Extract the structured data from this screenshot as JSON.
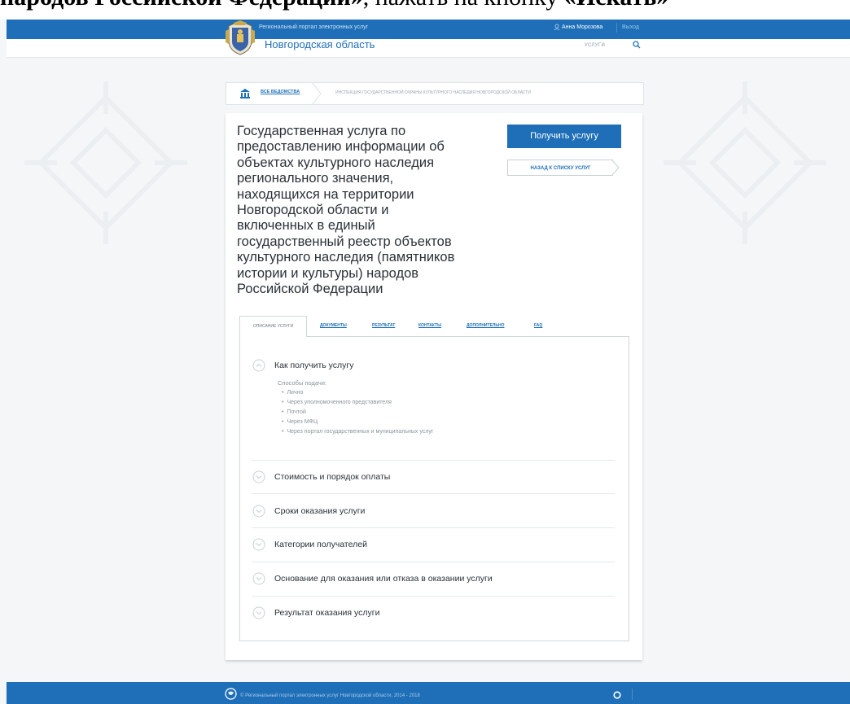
{
  "caption": {
    "part1": "народов Российской Федерации»",
    "part2": ", нажать на кнопку ",
    "part3": "«Искать»"
  },
  "topbar": {
    "portal_label": "Региональный портал электронных услуг",
    "user_name": "Анна Морозова",
    "logout_label": "Выход"
  },
  "header": {
    "region": "Новгородская область",
    "nav_services": "УСЛУГИ"
  },
  "breadcrumb": {
    "all_label": "ВСЕ ВЕДОМСТВА",
    "department": "ИНСПЕКЦИЯ ГОСУДАРСТВЕННОЙ ОХРАНЫ КУЛЬТУРНОГО НАСЛЕДИЯ НОВГОРОДСКОЙ ОБЛАСТИ"
  },
  "service": {
    "title": "Государственная услуга по\nпредоставлению информации об\nобъектах культурного наследия\nрегионального значения,\nнаходящихся на территории\nНовгородской области и\nвключенных в единый\nгосударственный реестр объектов\nкультурного наследия (памятников\nистории и культуры) народов\nРоссийской Федерации",
    "get_button": "Получить услугу",
    "back_button": "НАЗАД К СПИСКУ УСЛУГ"
  },
  "tabs": [
    "ОПИСАНИЕ УСЛУГИ",
    "ДОКУМЕНТЫ",
    "РЕЗУЛЬТАТ",
    "КОНТАКТЫ",
    "ДОПОЛНИТЕЛЬНО",
    "FAQ"
  ],
  "accordion": {
    "open_title": "Как получить услугу",
    "methods_heading": "Способы подачи:",
    "methods": [
      "Лично",
      "Через уполномоченного представителя",
      "Почтой",
      "Через МФЦ",
      "Через портал государственных и муниципальных услуг"
    ],
    "sections": [
      "Стоимость и порядок оплаты",
      "Сроки оказания услуги",
      "Категории получателей",
      "Основание для оказания или отказа в оказании услуги",
      "Результат оказания услуги"
    ]
  },
  "footer": {
    "copyright": "© Региональный портал электронных услуг Новгородской области, 2014 - 2018"
  },
  "colors": {
    "brand_blue": "#1e6fb7"
  }
}
